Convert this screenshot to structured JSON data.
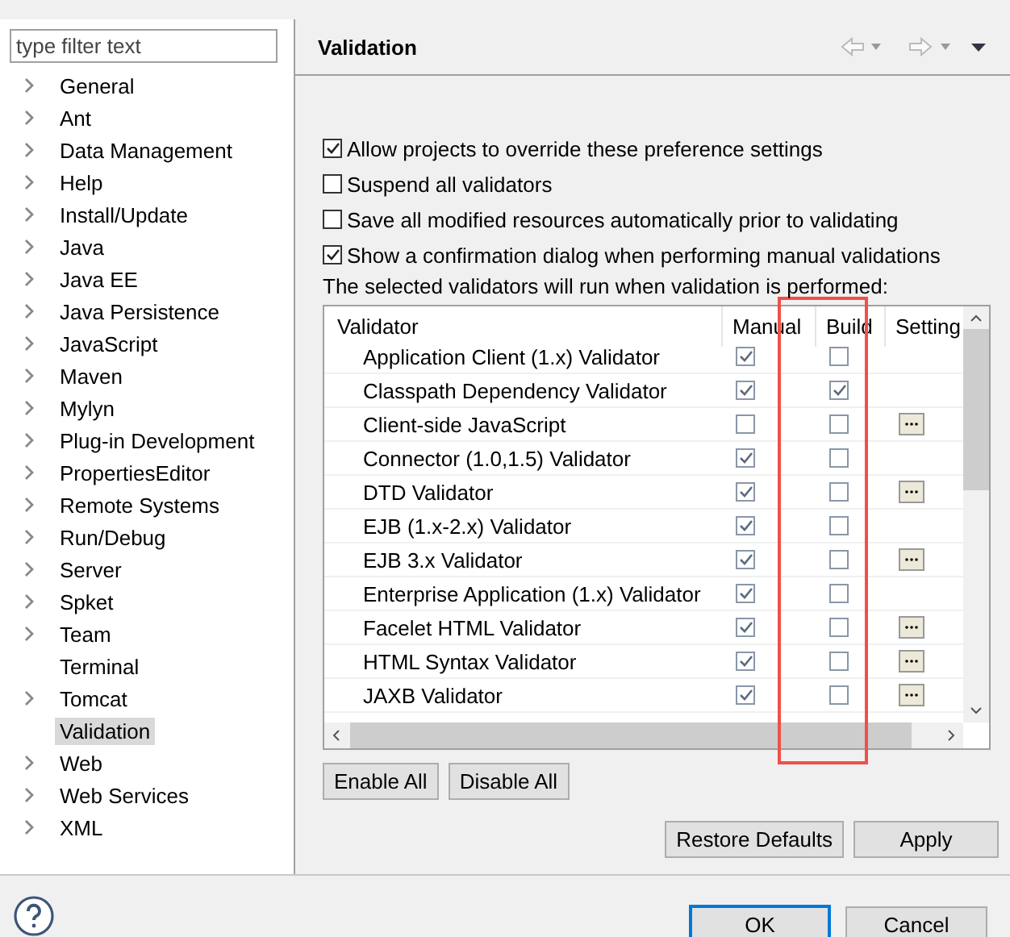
{
  "filter": {
    "placeholder": "type filter text"
  },
  "tree": [
    {
      "label": "General",
      "expandable": true,
      "selected": false
    },
    {
      "label": "Ant",
      "expandable": true,
      "selected": false
    },
    {
      "label": "Data Management",
      "expandable": true,
      "selected": false
    },
    {
      "label": "Help",
      "expandable": true,
      "selected": false
    },
    {
      "label": "Install/Update",
      "expandable": true,
      "selected": false
    },
    {
      "label": "Java",
      "expandable": true,
      "selected": false
    },
    {
      "label": "Java EE",
      "expandable": true,
      "selected": false
    },
    {
      "label": "Java Persistence",
      "expandable": true,
      "selected": false
    },
    {
      "label": "JavaScript",
      "expandable": true,
      "selected": false
    },
    {
      "label": "Maven",
      "expandable": true,
      "selected": false
    },
    {
      "label": "Mylyn",
      "expandable": true,
      "selected": false
    },
    {
      "label": "Plug-in Development",
      "expandable": true,
      "selected": false
    },
    {
      "label": "PropertiesEditor",
      "expandable": true,
      "selected": false
    },
    {
      "label": "Remote Systems",
      "expandable": true,
      "selected": false
    },
    {
      "label": "Run/Debug",
      "expandable": true,
      "selected": false
    },
    {
      "label": "Server",
      "expandable": true,
      "selected": false
    },
    {
      "label": "Spket",
      "expandable": true,
      "selected": false
    },
    {
      "label": "Team",
      "expandable": true,
      "selected": false
    },
    {
      "label": "Terminal",
      "expandable": false,
      "selected": false
    },
    {
      "label": "Tomcat",
      "expandable": true,
      "selected": false
    },
    {
      "label": "Validation",
      "expandable": false,
      "selected": true
    },
    {
      "label": "Web",
      "expandable": true,
      "selected": false
    },
    {
      "label": "Web Services",
      "expandable": true,
      "selected": false
    },
    {
      "label": "XML",
      "expandable": true,
      "selected": false
    }
  ],
  "page": {
    "title": "Validation"
  },
  "options": [
    {
      "label": "Allow projects to override these preference settings",
      "checked": true
    },
    {
      "label": "Suspend all validators",
      "checked": false
    },
    {
      "label": "Save all modified resources automatically prior to validating",
      "checked": false
    },
    {
      "label": "Show a confirmation dialog when performing manual validations",
      "checked": true
    }
  ],
  "table_caption": "The selected validators will run when validation is performed:",
  "table": {
    "columns": [
      "Validator",
      "Manual",
      "Build",
      "Setting"
    ],
    "rows": [
      {
        "name": "Application Client (1.x) Validator",
        "manual": true,
        "build": false,
        "settings": false
      },
      {
        "name": "Classpath Dependency Validator",
        "manual": true,
        "build": true,
        "settings": false
      },
      {
        "name": "Client-side JavaScript",
        "manual": false,
        "build": false,
        "settings": true
      },
      {
        "name": "Connector (1.0,1.5) Validator",
        "manual": true,
        "build": false,
        "settings": false
      },
      {
        "name": "DTD Validator",
        "manual": true,
        "build": false,
        "settings": true
      },
      {
        "name": "EJB (1.x-2.x) Validator",
        "manual": true,
        "build": false,
        "settings": false
      },
      {
        "name": "EJB 3.x Validator",
        "manual": true,
        "build": false,
        "settings": true
      },
      {
        "name": "Enterprise Application (1.x) Validator",
        "manual": true,
        "build": false,
        "settings": false
      },
      {
        "name": "Facelet HTML Validator",
        "manual": true,
        "build": false,
        "settings": true
      },
      {
        "name": "HTML Syntax Validator",
        "manual": true,
        "build": false,
        "settings": true
      },
      {
        "name": "JAXB Validator",
        "manual": true,
        "build": false,
        "settings": true
      }
    ]
  },
  "table_buttons": [
    "Enable All",
    "Disable All"
  ],
  "page_buttons": [
    "Restore Defaults",
    "Apply"
  ],
  "dialog_buttons": [
    {
      "label": "OK",
      "default": true
    },
    {
      "label": "Cancel",
      "default": false
    }
  ]
}
